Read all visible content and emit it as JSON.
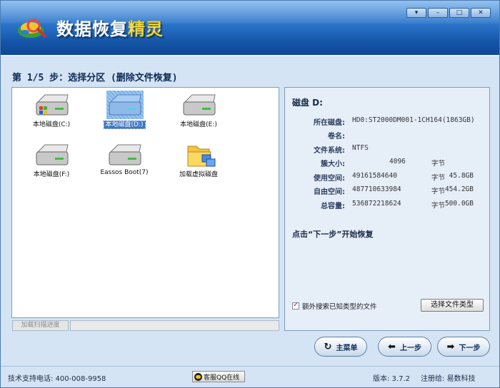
{
  "window": {
    "title_main": "数据恢复",
    "title_accent": "精灵",
    "controls": [
      "▾",
      "–",
      "□",
      "✕"
    ]
  },
  "step_title": "第 1/5 步：选择分区 (删除文件恢复)",
  "drives": [
    {
      "label": "本地磁盘(C:)",
      "icon": "windows-drive-icon",
      "selected": false
    },
    {
      "label": "本地磁盘(D:)",
      "icon": "hard-drive-icon",
      "selected": true
    },
    {
      "label": "本地磁盘(E:)",
      "icon": "hard-drive-icon",
      "selected": false
    },
    {
      "label": "本地磁盘(F:)",
      "icon": "hard-drive-icon",
      "selected": false
    },
    {
      "label": "Eassos Boot(7)",
      "icon": "hard-drive-icon",
      "selected": false
    },
    {
      "label": "加载虚拟磁盘",
      "icon": "folder-virtual-disk-icon",
      "selected": false
    }
  ],
  "progress": {
    "label": "加载扫描进度",
    "value": 0
  },
  "info": {
    "disk_header": "磁盘 D:",
    "rows": [
      {
        "key": "所在磁盘:",
        "value": "HD0:ST2000DM001-1CH164(1863GB)",
        "unit": "",
        "size": ""
      },
      {
        "key": "卷名:",
        "value": "",
        "unit": "",
        "size": ""
      },
      {
        "key": "文件系统:",
        "value": "NTFS",
        "unit": "",
        "size": ""
      },
      {
        "key": "簇大小:",
        "value": "4096",
        "unit": "字节",
        "size": ""
      },
      {
        "key": "使用空间:",
        "value": "49161584640",
        "unit": "字节",
        "size": "45.8GB"
      },
      {
        "key": "自由空间:",
        "value": "487710633984",
        "unit": "字节",
        "size": "454.2GB"
      },
      {
        "key": "总容量:",
        "value": "536872218624",
        "unit": "字节",
        "size": "500.0GB"
      }
    ],
    "hint": "点击“下一步”开始恢复",
    "extra_search_label": "额外搜索已知类型的文件",
    "extra_search_checked": true,
    "file_type_button": "选择文件类型"
  },
  "nav": {
    "main_menu": "主菜单",
    "prev": "上一步",
    "next": "下一步"
  },
  "status": {
    "support": "技术支持电话: 400-008-9958",
    "qq": "客服QQ在线",
    "version": "版本: 3.7.2",
    "registered": "注册给: 易数科技"
  },
  "colors": {
    "banner": "#1556a8",
    "accent": "#f2d21c",
    "selection": "#3a78c8"
  }
}
